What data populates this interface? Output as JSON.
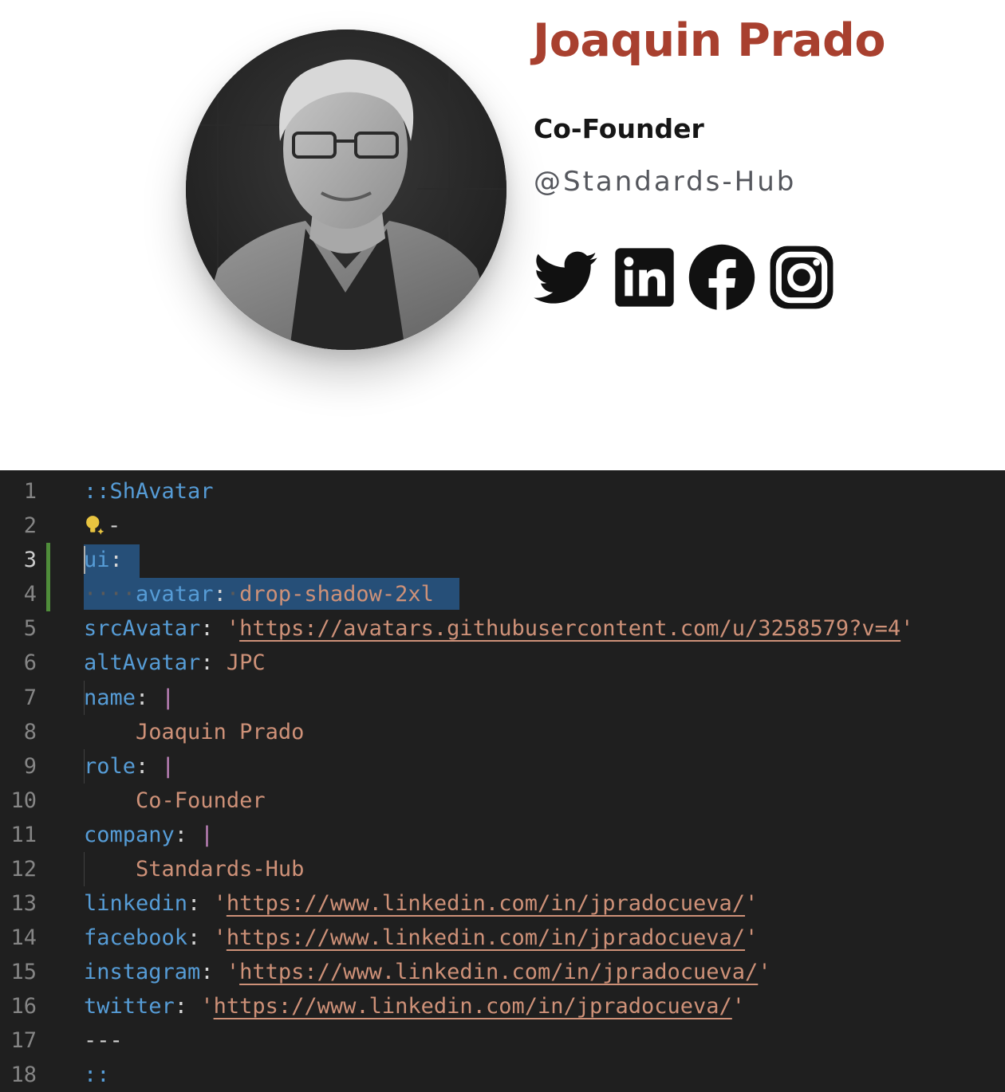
{
  "profile": {
    "name": "Joaquin Prado",
    "role": "Co-Founder",
    "company": "@Standards-Hub",
    "accent_color": "#a8402f",
    "social_icons": [
      "twitter-icon",
      "linkedin-icon",
      "facebook-icon",
      "instagram-icon"
    ]
  },
  "editor": {
    "line_numbers": [
      "1",
      "2",
      "3",
      "4",
      "5",
      "6",
      "7",
      "8",
      "9",
      "10",
      "11",
      "12",
      "13",
      "14",
      "15",
      "16",
      "17",
      "18"
    ],
    "lines": {
      "l1": "::ShAvatar",
      "l2_dash": "-",
      "l3_key": "ui",
      "l4_key": "avatar",
      "l4_value": "drop-shadow-2xl",
      "l5_key": "srcAvatar",
      "l5_url": "https://avatars.githubusercontent.com/u/3258579?v=4",
      "l6_key": "altAvatar",
      "l6_value": "JPC",
      "l7_key": "name",
      "l8_value": "Joaquin Prado",
      "l9_key": "role",
      "l10_value": "Co-Founder",
      "l11_key": "company",
      "l12_value": "Standards-Hub",
      "l13_key": "linkedin",
      "l13_url": "https://www.linkedin.com/in/jpradocueva/",
      "l14_key": "facebook",
      "l14_url": "https://www.linkedin.com/in/jpradocueva/",
      "l15_key": "instagram",
      "l15_url": "https://www.linkedin.com/in/jpradocueva/",
      "l16_key": "twitter",
      "l16_url": "https://www.linkedin.com/in/jpradocueva/",
      "l17": "---",
      "l18": "::"
    },
    "colors": {
      "background": "#1f1f1f",
      "key": "#569cd6",
      "string": "#ce9178",
      "selection": "#264f78",
      "modified_gutter": "#4f8c3a"
    },
    "lightbulb_icon": "lightbulb-sparkle-icon"
  }
}
